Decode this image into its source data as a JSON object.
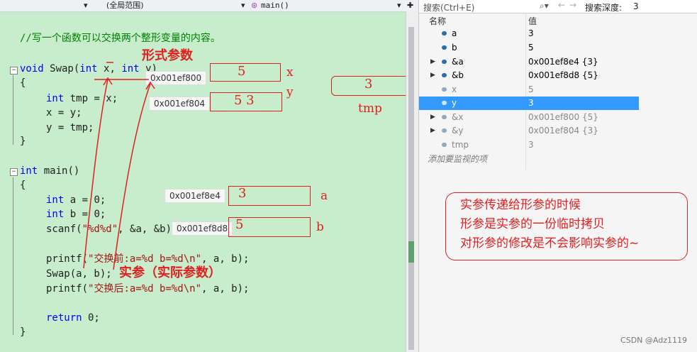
{
  "toolbar": {
    "scope_label": "(全局范围)",
    "func_label": "main()",
    "search_placeholder": "搜索(Ctrl+E)",
    "depth_label": "搜索深度:",
    "depth_value": "3"
  },
  "code": {
    "comment": "//写一个函数可以交换两个整形变量的内容。",
    "line_void": "void",
    "line_swap_sig": " Swap(",
    "line_int1": "int",
    "line_x": " x, ",
    "line_int2": "int",
    "line_y": " y)",
    "brace_open": "{",
    "brace_close": "}",
    "tmp_kw": "int",
    "tmp_rest": " tmp = x;",
    "x_assign": "x = y;",
    "y_assign": "y = tmp;",
    "main_kw": "int",
    "main_rest": " main()",
    "a_kw": "int",
    "a_rest": " a = 0;",
    "b_kw": "int",
    "b_rest": " b = 0;",
    "scanf_pre": "scanf(",
    "scanf_str": "\"%d%d\"",
    "scanf_post": ", &a, &b);",
    "printf1_pre": "printf(",
    "printf1_str": "\"交换前:a=%d b=%d\\n\"",
    "printf1_post": ", a, b);",
    "swap_call": "Swap(a, b);",
    "printf2_pre": "printf(",
    "printf2_str": "\"交换后:a=%d b=%d\\n\"",
    "printf2_post": ", a, b);",
    "return_kw": "return",
    "return_rest": " 0;"
  },
  "tooltips": {
    "x_addr": "0x001ef800",
    "y_addr": "0x001ef804",
    "a_addr": "0x001ef8e4",
    "b_addr": "0x001ef8d8"
  },
  "watch": {
    "col_name": "名称",
    "col_value": "值",
    "rows": [
      {
        "name": "a",
        "value": "3"
      },
      {
        "name": "b",
        "value": "5"
      },
      {
        "name": "&a",
        "value": "0x001ef8e4 {3}"
      },
      {
        "name": "&b",
        "value": "0x001ef8d8 {5}"
      },
      {
        "name": "x",
        "value": "5"
      },
      {
        "name": "y",
        "value": "3"
      },
      {
        "name": "&x",
        "value": "0x001ef800 {5}"
      },
      {
        "name": "&y",
        "value": "0x001ef804 {3}"
      },
      {
        "name": "tmp",
        "value": "3"
      }
    ],
    "add_item": "添加要监视的项"
  },
  "annotations": {
    "formal_params": "形式参数",
    "actual_params": "实参（实际参数）",
    "x_label": "x",
    "y_label": "y",
    "tmp_label": "tmp",
    "a_label": "a",
    "b_label": "b",
    "x_box_val": "5",
    "y_box_val": "5 3",
    "tmp_box_val": "3",
    "a_box_val": "3",
    "b_box_val": "5",
    "note_line1": "实参传递给形参的时候",
    "note_line2": "形参是实参的一份临时拷贝",
    "note_line3": "对形参的修改是不会影响实参的~"
  },
  "watermark": "CSDN @Adz1119"
}
